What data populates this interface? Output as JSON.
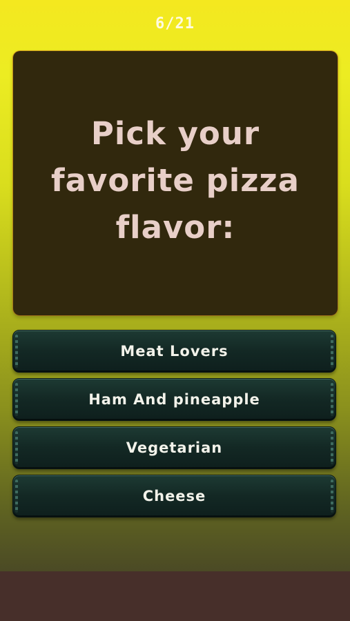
{
  "progress": {
    "text": "6/21",
    "current": 6,
    "total": 21
  },
  "question": {
    "text": "Pick your favorite pizza flavor:"
  },
  "answers": [
    {
      "label": "Meat Lovers"
    },
    {
      "label": "Ham And pineapple"
    },
    {
      "label": "Vegetarian"
    },
    {
      "label": "Cheese"
    }
  ],
  "colors": {
    "background_top": "#f4e81f",
    "background_bottom": "#4b4a25",
    "card": "#31280d",
    "question_text": "#e8cfc8",
    "button": "#132824",
    "button_text": "#f2f2ea",
    "bottom_band": "#472f2a"
  }
}
